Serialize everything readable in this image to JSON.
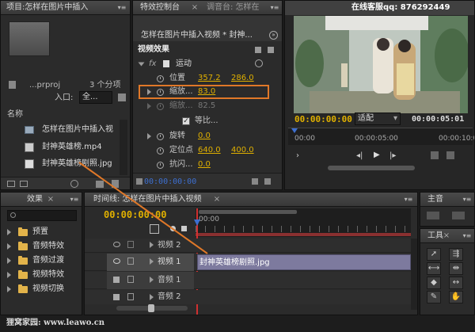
{
  "project": {
    "tab": "项目:怎样在图片中插入",
    "file_name": "...prproj",
    "item_count": "3 个分项",
    "entry_label": "入口:",
    "entry_value": "全...",
    "column_name": "名称",
    "items": [
      "怎样在图片中插入视",
      "封神英雄榜.mp4",
      "封神英雄榜剧照.jpg"
    ]
  },
  "effect_controls": {
    "tab_active": "特效控制台",
    "tab_mixer": "调音台: 怎样在",
    "sequence_title": "怎样在图片中插入视频 * 封神...",
    "section": "视频效果",
    "motion_label": "运动",
    "position_label": "位置",
    "position_x": "357.2",
    "position_y": "286.0",
    "scale_label": "缩放...",
    "scale_value": "83.0",
    "scale_width_label": "缩放...",
    "scale_width_value": "82.5",
    "uniform_label": "等比...",
    "rotation_label": "旋转",
    "rotation_value": "0.0",
    "anchor_label": "定位点",
    "anchor_x": "640.0",
    "anchor_y": "400.0",
    "flicker_label": "抗闪...",
    "flicker_value": "0.0",
    "timecode": "00:00:00:00"
  },
  "monitor": {
    "header": "在线客服qq: 876292449",
    "timecode_current": "00:00:00:00",
    "fit_label": "适配",
    "timecode_duration": "00:00:05:01",
    "ruler_start": "00:00",
    "ruler_mid": "00:00:05:00",
    "ruler_end": "00:00:10:00"
  },
  "effects_panel": {
    "tab": "效果",
    "items": [
      "预置",
      "音频特效",
      "音频过渡",
      "视频特效",
      "视频切换"
    ]
  },
  "timeline": {
    "tab": "时间线: 怎样在图片中插入视频",
    "timecode": "00:00:00:00",
    "ruler_label": "00:00",
    "tracks": [
      {
        "name": "视频 2"
      },
      {
        "name": "视频 1"
      },
      {
        "name": "音频 1"
      },
      {
        "name": "音频 2"
      }
    ],
    "clip_label": "封神英雄榜剧照.jpg"
  },
  "master_panel": {
    "tab": "主音"
  },
  "tools_panel": {
    "tab": "工具"
  },
  "watermark": "狸窝家园: www.leawo.cn",
  "colors": {
    "accent": "#e0b000",
    "highlight_box": "#e07828",
    "playhead": "#d03030",
    "blue": "#3d6fd0"
  }
}
